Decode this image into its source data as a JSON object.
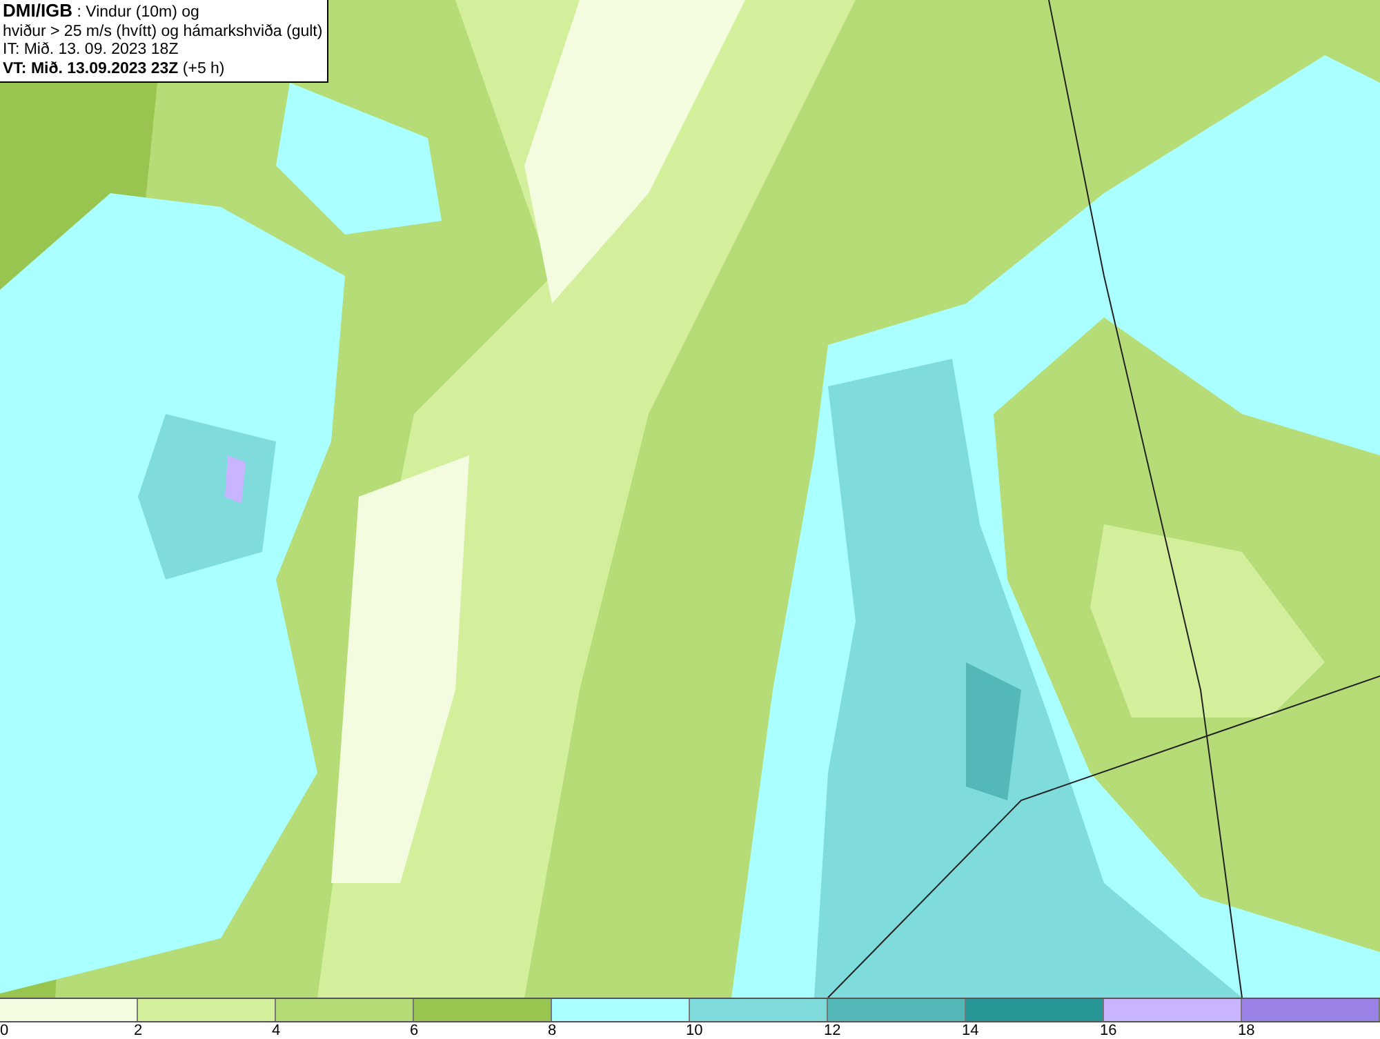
{
  "title_box": {
    "lines": [
      "**DMI/IGB** : Vindur (10m) og",
      "hviður > 25 m/s (hvítt) og hámarkshviða (gult)",
      "IT: Mið. 13. 09. 2023 18Z",
      "**VT: Mið. 13.09.2023 23Z** (+5 h)"
    ]
  },
  "legend": {
    "segments": [
      {
        "color": "#f4fce0"
      },
      {
        "color": "#d4ef9c"
      },
      {
        "color": "#b6dc78"
      },
      {
        "color": "#98c450"
      },
      {
        "color": "#aaffff"
      },
      {
        "color": "#80dcdc"
      },
      {
        "color": "#55b8b8"
      },
      {
        "color": "#269696"
      },
      {
        "color": "#c8b4ff"
      },
      {
        "color": "#9b82e6"
      }
    ],
    "ticks": [
      "0",
      "2",
      "4",
      "6",
      "8",
      "10",
      "12",
      "14",
      "16",
      "18"
    ]
  }
}
